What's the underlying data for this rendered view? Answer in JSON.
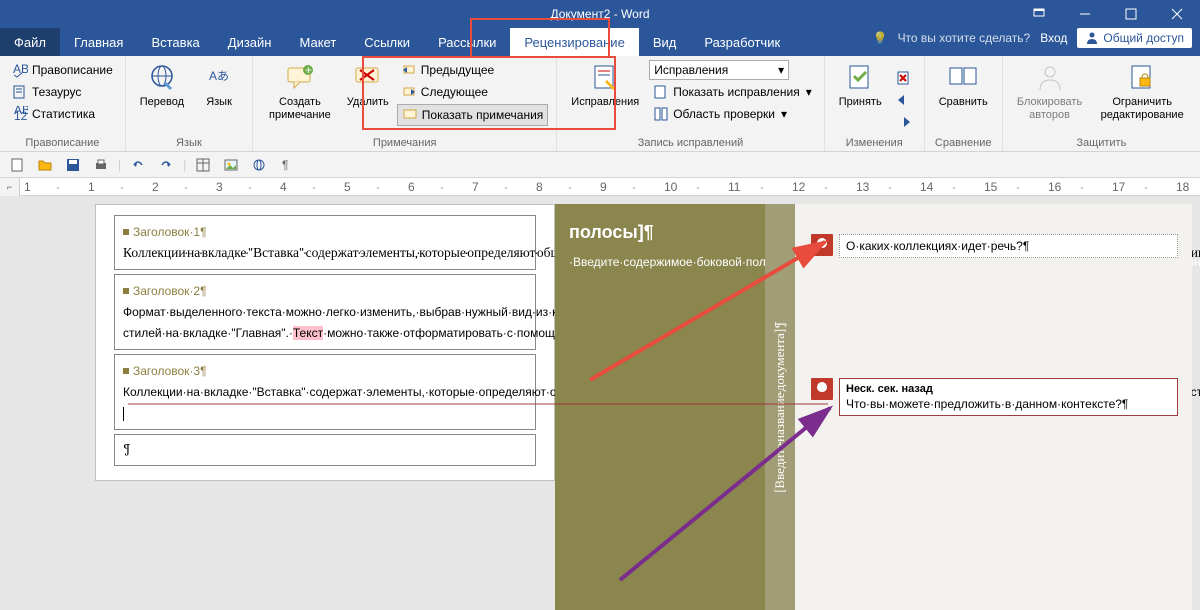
{
  "title": "Документ2 - Word",
  "tabs": {
    "file": "Файл",
    "home": "Главная",
    "insert": "Вставка",
    "design": "Дизайн",
    "layout": "Макет",
    "references": "Ссылки",
    "mailings": "Рассылки",
    "review": "Рецензирование",
    "view": "Вид",
    "developer": "Разработчик"
  },
  "tell_me": "Что вы хотите сделать?",
  "login": "Вход",
  "share": "Общий доступ",
  "ribbon": {
    "proofing": {
      "spelling": "Правописание",
      "thesaurus": "Тезаурус",
      "stats": "Статистика",
      "label": "Правописание"
    },
    "language": {
      "translate": "Перевод",
      "language": "Язык",
      "label": "Язык"
    },
    "comments": {
      "new": "Создать примечание",
      "delete": "Удалить",
      "prev": "Предыдущее",
      "next": "Следующее",
      "show": "Показать примечания",
      "label": "Примечания"
    },
    "tracking": {
      "track": "Исправления",
      "display_dd": "Исправления",
      "show_markup": "Показать исправления",
      "pane": "Область проверки",
      "label": "Запись исправлений"
    },
    "changes": {
      "accept": "Принять",
      "label": "Изменения"
    },
    "compare": {
      "compare": "Сравнить",
      "label": "Сравнение"
    },
    "protect": {
      "block": "Блокировать авторов",
      "restrict": "Ограничить редактирование",
      "label": "Защитить"
    }
  },
  "document": {
    "h1": "Заголовок·1¶",
    "p1": "Коллекции·на·вкладке·\"Вставка\"·содержат·элементы,·которые·определяют·общий·вид·документа.·Эти·коллекции·служат·для·вставки·в·документ·таблиц,·колонтитулов,·списков,·титульных·страниц·и·других·стандартных·блоков.¶",
    "h2": "Заголовок·2¶",
    "p2a": "Формат·выделенного·текста·можно·легко·изменить,·выбрав·нужный·вид·из·коллекции·экспресс-стилей·на·вкладке·\"Главная\".·",
    "p2_hl": "Текст",
    "p2b": "·можно·также·отформатировать·с·помощью·других·элементов·управления·на·вкладке·\"Главная\".·¶",
    "h3": "Заголовок·3¶",
    "p3": "Коллекции·на·вкладке·\"Вставка\"·содержат·элементы,·которые·определяют·общий·вид·документа.·Эти·коллекции·служат·для·вставки·в·документ·таблиц,·колонтитулов,·списков,·титульных·страниц·и·других·стандартных·блоков.¶",
    "empty": "¶"
  },
  "sidebar": {
    "title": "полосы]¶",
    "body": "·Введите·содержимое·боковой·полосы.·Боковая·полоса·представляет·собой·независимое·дополнение·к·основному·документу.·Обычно·она·выровнена·по·левому·или·правому·краю·"
  },
  "vert": "[Введите·название·документа]¶",
  "comments": [
    {
      "text": "О·каких·коллекциях·идет·речь?¶"
    },
    {
      "meta": "Неск. сек. назад",
      "text": "Что·вы·можете·предложить·в·данном·контексте?¶"
    }
  ],
  "ruler_ticks": [
    "1",
    "·",
    "1",
    "·",
    "·",
    "1",
    "·",
    "2",
    "·",
    "3",
    "·",
    "4",
    "·",
    "5",
    "·",
    "6",
    "·",
    "7",
    "·",
    "8",
    "·",
    "9",
    "·",
    "10",
    "·",
    "11",
    "·",
    "12",
    "·",
    "13",
    "·",
    "14",
    "·",
    "15",
    "·",
    "16",
    "·",
    "17",
    "·"
  ]
}
